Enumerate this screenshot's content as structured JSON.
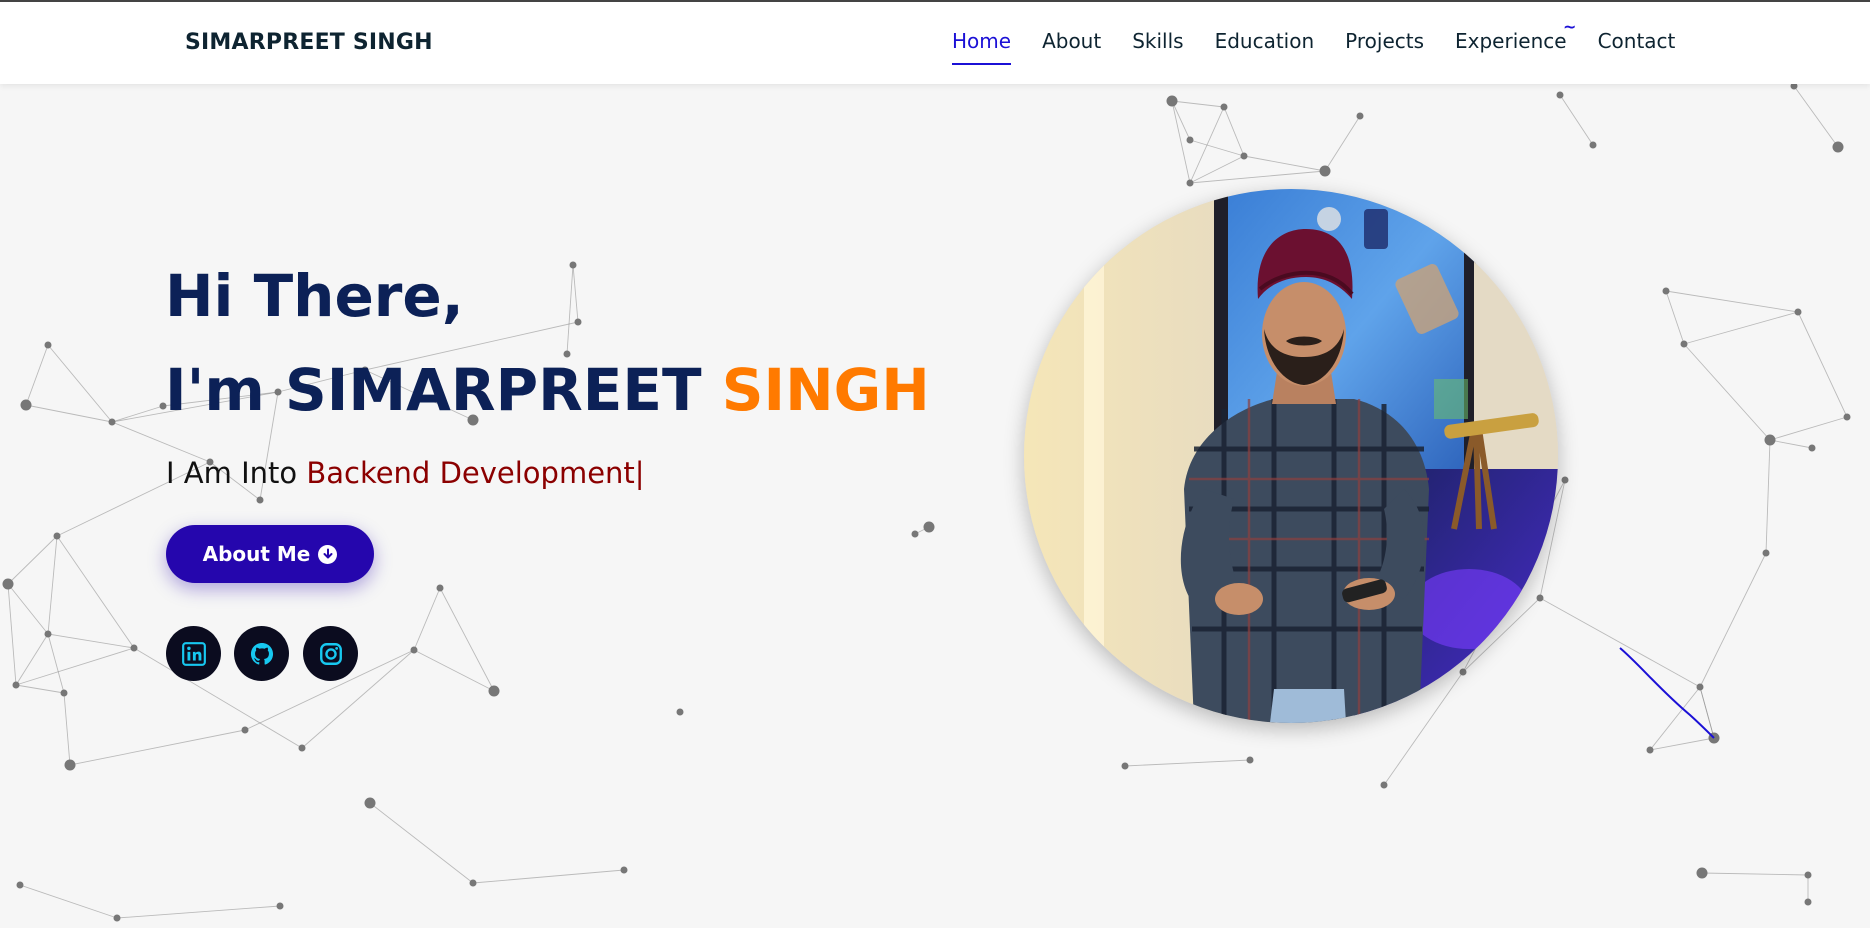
{
  "header": {
    "brand": "SIMARPREET SINGH",
    "nav": [
      {
        "label": "Home",
        "active": true
      },
      {
        "label": "About",
        "active": false
      },
      {
        "label": "Skills",
        "active": false
      },
      {
        "label": "Education",
        "active": false
      },
      {
        "label": "Projects",
        "active": false
      },
      {
        "label": "Experience",
        "active": false
      },
      {
        "label": "Contact",
        "active": false
      }
    ],
    "stray_mark": "~"
  },
  "hero": {
    "greeting": "Hi There,",
    "name_prefix": "I'm SIMARPREET ",
    "name_accent": "SINGH",
    "tagline_prefix": "I Am Into ",
    "tagline_role": "Backend Development",
    "typing_cursor": "|",
    "button_label": "About Me",
    "button_icon": "arrow-down-circle-icon",
    "socials": [
      {
        "icon": "linkedin-icon"
      },
      {
        "icon": "github-icon"
      },
      {
        "icon": "instagram-icon"
      }
    ],
    "photo": "profile-photo"
  },
  "colors": {
    "nav_active": "#1b10d6",
    "heading": "#0c2157",
    "accent": "#ff7a00",
    "role": "#8b0000",
    "button": "#2506ad",
    "social_bg": "#0b0c1f",
    "social_icon": "#17c8f0"
  }
}
